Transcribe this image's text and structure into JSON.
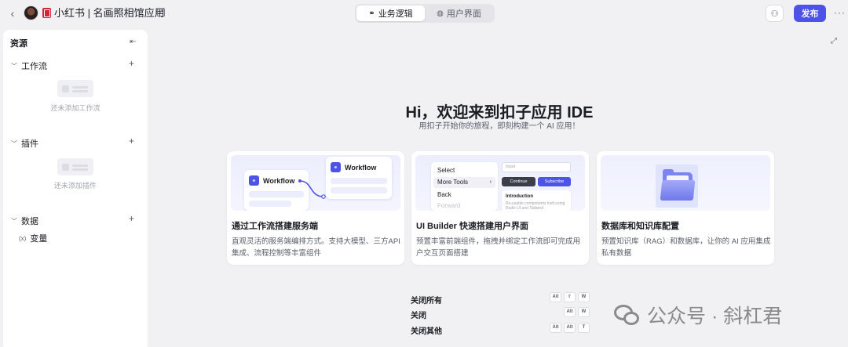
{
  "topbar": {
    "app_title": "小红书 | 名画照相馆应用",
    "tabs": [
      {
        "label": "业务逻辑",
        "active": true
      },
      {
        "label": "用户界面",
        "active": false
      }
    ],
    "publish_label": "发布"
  },
  "sidebar": {
    "title": "资源",
    "groups": [
      {
        "label": "工作流",
        "empty_text": "还未添加工作流"
      },
      {
        "label": "插件",
        "empty_text": "还未添加插件"
      },
      {
        "label": "数据",
        "items": [
          "变量"
        ]
      }
    ]
  },
  "main": {
    "hero_title": "Hi，欢迎来到扣子应用 IDE",
    "hero_subtitle": "用扣子开始你的旅程，即刻构建一个 AI 应用！",
    "cards": [
      {
        "title": "通过工作流搭建服务端",
        "description": "直观灵活的服务端编排方式。支持大模型、三方API集成、流程控制等丰富组件",
        "preview": {
          "node_a": "Workflow",
          "node_b": "Workflow"
        }
      },
      {
        "title": "UI Builder 快速搭建用户界面",
        "description": "预置丰富前端组件，拖拽并绑定工作流即可完成用户交互页面搭建",
        "preview": {
          "menu": [
            "Select",
            "More Tools",
            "Back",
            "Forward"
          ],
          "input_placeholder": "Input",
          "btn_continue": "Continue",
          "btn_subscribe": "Subscribe",
          "intro_title": "Introduction",
          "intro_desc": "Re-usable components built using Radix UI and Tailwind"
        }
      },
      {
        "title": "数据库和知识库配置",
        "description": "预置知识库（RAG）和数据库，让你的 AI 应用集成私有数据"
      }
    ],
    "shortcuts": [
      {
        "label": "关闭所有",
        "keys": [
          "Alt",
          "⇧",
          "W"
        ]
      },
      {
        "label": "关闭",
        "keys": [
          "Alt",
          "W"
        ]
      },
      {
        "label": "关闭其他",
        "keys": [
          "Alt",
          "Alt",
          "T"
        ]
      }
    ]
  },
  "watermark": {
    "text": "公众号 · 斜杠君"
  }
}
